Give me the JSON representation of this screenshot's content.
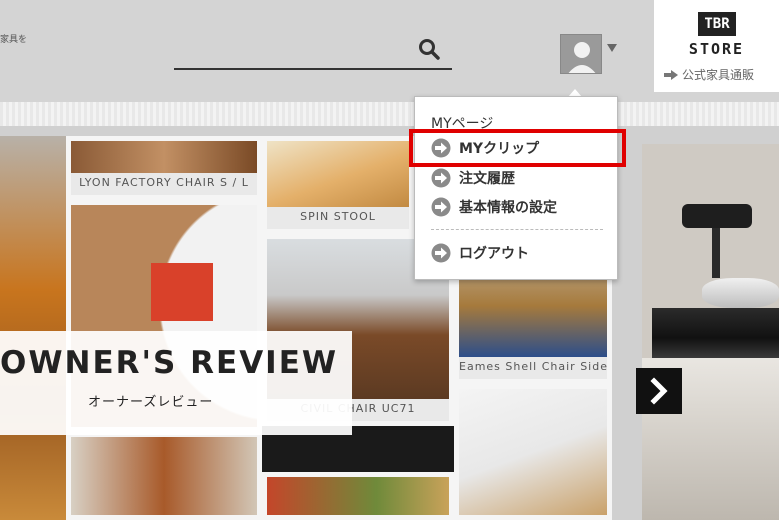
{
  "header": {
    "note": "家具を",
    "search": {
      "value": ""
    },
    "store": {
      "logo_text": "TBR",
      "name": "STORE",
      "link_label": "公式家具通販"
    }
  },
  "dropdown": {
    "heading": "MYページ",
    "items": [
      {
        "label": "MYクリップ"
      },
      {
        "label": "注文履歴"
      },
      {
        "label": "基本情報の設定"
      },
      {
        "label": "ログアウト"
      }
    ]
  },
  "tiles": [
    {
      "caption": "LYON FACTORY CHAIR S / L"
    },
    {
      "caption": "SPIN STOOL"
    },
    {
      "caption": "Eames Shell Chair Side"
    },
    {
      "caption": "CIVIL CHAIR UC71"
    }
  ],
  "banner": {
    "title": "OWNER'S REVIEW",
    "subtitle": "オーナーズレビュー"
  },
  "colors": {
    "highlight": "#e00000",
    "header_bg": "#d4d4d4"
  },
  "icons": {
    "search": "search-icon",
    "avatar": "user-avatar-icon",
    "menu_bullet": "arrow-circle-icon",
    "next": "chevron-right-icon"
  }
}
